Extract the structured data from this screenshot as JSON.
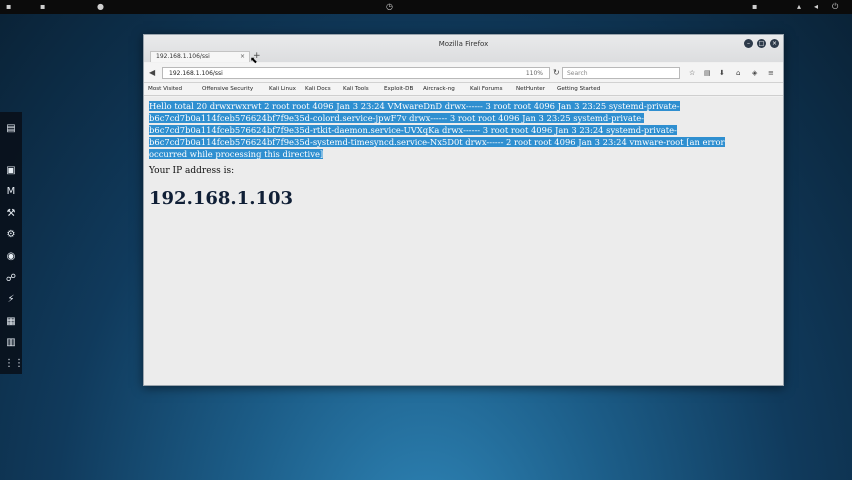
{
  "desktop": {
    "topbar_items": [
      "",
      "",
      "",
      "",
      "",
      "",
      "",
      "",
      "",
      "",
      ""
    ],
    "dock_icons": [
      "files-icon",
      "terminal-icon",
      "mail-icon",
      "tools-icon",
      "settings-icon",
      "browser-icon",
      "network-icon",
      "tool-icon",
      "app-icon",
      "grid-icon",
      "apps-grid-icon"
    ]
  },
  "browser": {
    "window_title": "Mozilla Firefox",
    "tab": {
      "label": "192.168.1.106/ssi",
      "close": "×"
    },
    "new_tab": "+",
    "url": "192.168.1.106/ssi",
    "zoom": "110%",
    "search_placeholder": "Search",
    "bookmarks": [
      "Most Visited",
      "Offensive Security",
      "Kali Linux",
      "Kali Docs",
      "Kali Tools",
      "Exploit-DB",
      "Aircrack-ng",
      "Kali Forums",
      "NetHunter",
      "Getting Started"
    ]
  },
  "page": {
    "selected_text": "Hello total 20 drwxrwxrwt 2 root root 4096 Jan 3 23:24 VMwareDnD drwx------ 3 root root 4096 Jan 3 23:25 systemd-private-b6c7cd7b0a114fceb576624bf7f9e35d-colord.service-jpwF7v drwx------ 3 root root 4096 Jan 3 23:25 systemd-private-b6c7cd7b0a114fceb576624bf7f9e35d-rtkit-daemon.service-UVXqKa drwx------ 3 root root 4096 Jan 3 23:24 systemd-private-b6c7cd7b0a114fceb576624bf7f9e35d-systemd-timesyncd.service-Nx5D0t drwx------ 2 root root 4096 Jan 3 23:24 vmware-root [an error occurred while processing this directive]",
    "ip_label": "Your IP address is:",
    "ip_value": "192.168.1.103"
  },
  "colors": {
    "selection": "#2f8fd0",
    "desktop": "#1c5d88"
  }
}
